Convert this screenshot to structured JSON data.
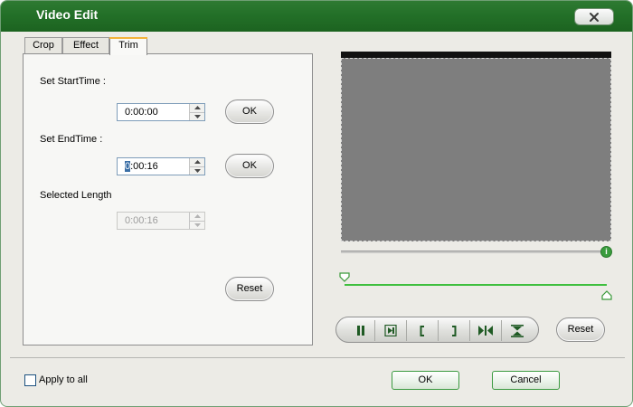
{
  "window": {
    "title": "Video Edit"
  },
  "tabs": [
    {
      "label": "Crop"
    },
    {
      "label": "Effect"
    },
    {
      "label": "Trim"
    }
  ],
  "trim": {
    "start_label": "Set StartTime :",
    "start_value": "0:00:00",
    "start_ok": "OK",
    "end_label": "Set EndTime :",
    "end_value_caret": "0",
    "end_value_rest": ":00:16",
    "end_ok": "OK",
    "length_label": "Selected Length",
    "length_value": "0:00:16",
    "reset_label": "Reset"
  },
  "player": {
    "reset_label": "Reset",
    "controls": [
      "pause-icon",
      "step-frame-icon",
      "mark-in-icon",
      "mark-out-icon",
      "skip-to-mark-icon",
      "trim-region-icon"
    ]
  },
  "footer": {
    "apply_all_label": "Apply to all",
    "apply_all_checked": false,
    "ok_label": "OK",
    "cancel_label": "Cancel"
  },
  "colors": {
    "title_bar": "#237028",
    "accent_green": "#3fbf3f",
    "active_tab_highlight": "#f3b23a"
  }
}
